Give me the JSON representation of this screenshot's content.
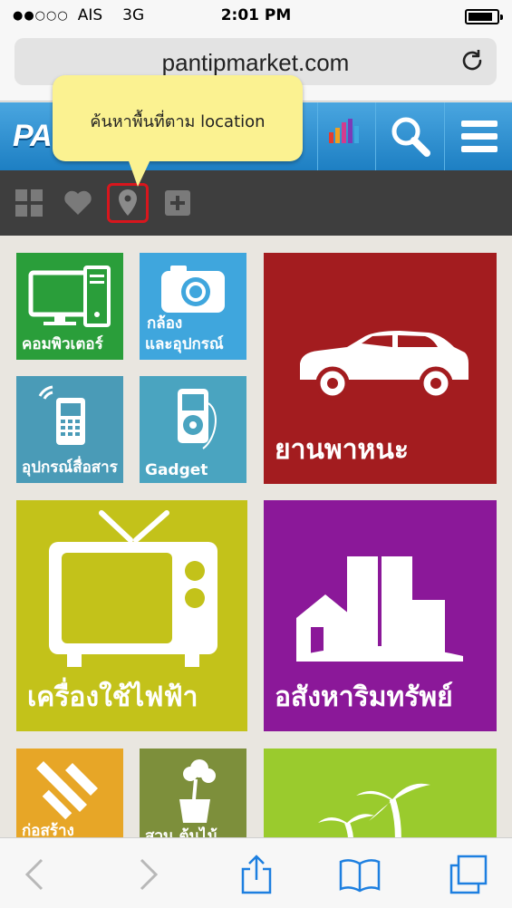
{
  "status_bar": {
    "signal_dots": "●●○○○",
    "carrier": "AIS",
    "network": "3G",
    "time": "2:01 PM"
  },
  "browser": {
    "url": "pantipmarket.com",
    "reload_icon": "reload-icon"
  },
  "site_header": {
    "logo_text": "PA",
    "icons": [
      "stats-icon",
      "search-icon",
      "menu-icon"
    ]
  },
  "tooltip": {
    "text": "ค้นหาพื้นที่ตาม location"
  },
  "toolbar": {
    "icons": [
      "grid-icon",
      "heart-icon",
      "location-pin-icon",
      "plus-icon"
    ],
    "highlight_color": "#d8161d"
  },
  "categories": [
    {
      "label": "คอมพิวเตอร์",
      "icon": "computer-icon",
      "color": "#2a9e3a"
    },
    {
      "label_line1": "กล้อง",
      "label_line2": "และอุปกรณ์",
      "icon": "camera-icon",
      "color": "#3fa6dd"
    },
    {
      "label": "อุปกรณ์สื่อสาร",
      "icon": "phone-icon",
      "color": "#4a9bb7"
    },
    {
      "label": "Gadget",
      "icon": "gadget-icon",
      "color": "#4aa4c0"
    },
    {
      "label": "ยานพาหนะ",
      "icon": "car-icon",
      "color": "#a31c1f"
    },
    {
      "label": "เครื่องใช้ไฟฟ้า",
      "icon": "tv-icon",
      "color": "#c3c21a"
    },
    {
      "label": "อสังหาริมทรัพย์",
      "icon": "buildings-icon",
      "color": "#8b1899"
    },
    {
      "label": "ก่อสร้าง",
      "icon": "tools-icon",
      "color": "#e7a627"
    },
    {
      "label": "สวน ต้นไม้",
      "icon": "plant-icon",
      "color": "#7d8f3b"
    },
    {
      "label": "",
      "icon": "palm-tree-icon",
      "color": "#9acb2d"
    }
  ],
  "bottom_bar": {
    "icons": [
      "back-icon",
      "forward-icon",
      "share-icon",
      "bookmarks-icon",
      "tabs-icon"
    ]
  }
}
